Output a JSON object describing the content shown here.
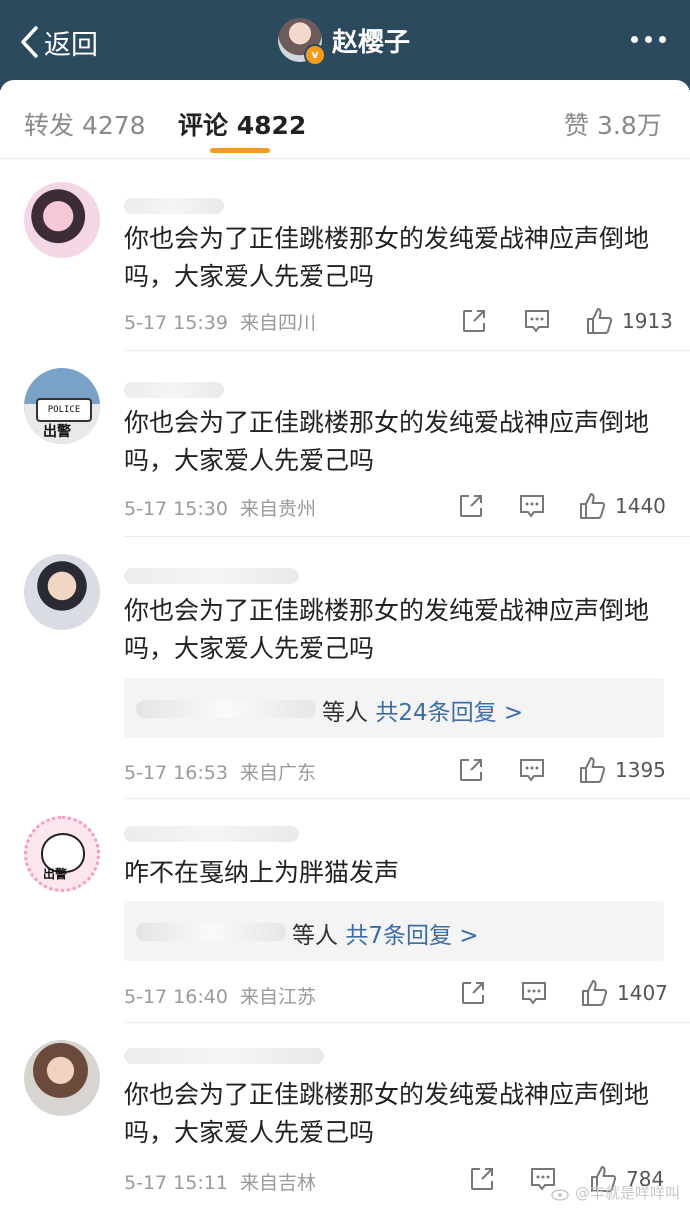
{
  "header": {
    "back_label": "返回",
    "title": "赵樱子"
  },
  "tabs": [
    {
      "label": "转发",
      "count": "4278"
    },
    {
      "label": "评论",
      "count": "4822"
    },
    {
      "label": "赞",
      "count": "3.8万"
    }
  ],
  "comments": [
    {
      "text": "你也会为了正佳跳楼那女的发纯爱战神应声倒地吗，大家爱人先爱己吗",
      "time": "5-17 15:39",
      "location": "来自四川",
      "likes": "1913"
    },
    {
      "text": "你也会为了正佳跳楼那女的发纯爱战神应声倒地吗，大家爱人先爱己吗",
      "avatar_text": "出警",
      "avatar_badge": "POLICE",
      "time": "5-17 15:30",
      "location": "来自贵州",
      "likes": "1440"
    },
    {
      "text": "你也会为了正佳跳楼那女的发纯爱战神应声倒地吗，大家爱人先爱己吗",
      "reply_suffix": "等人",
      "reply_link": "共24条回复 >",
      "time": "5-17 16:53",
      "location": "来自广东",
      "likes": "1395"
    },
    {
      "text": "咋不在戛纳上为胖猫发声",
      "avatar_text": "出警",
      "reply_suffix": "等人",
      "reply_link": "共7条回复 >",
      "time": "5-17 16:40",
      "location": "来自江苏",
      "likes": "1407"
    },
    {
      "text": "你也会为了正佳跳楼那女的发纯爱战神应声倒地吗，大家爱人先爱己吗",
      "time": "5-17 15:11",
      "location": "来自吉林",
      "likes": "784"
    }
  ],
  "watermark": "@丰就是咩咩叫",
  "colors": {
    "header_bg": "#2c4a5e",
    "accent": "#f59a23",
    "link": "#3b6ea8"
  }
}
